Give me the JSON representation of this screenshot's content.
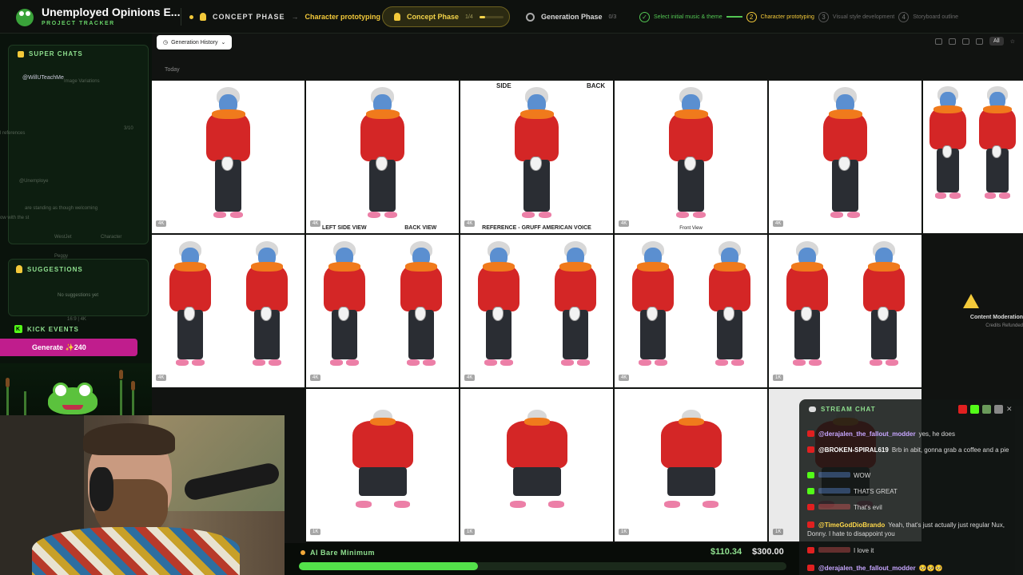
{
  "header": {
    "app_title": "Unemployed Opinions E...",
    "app_subtitle": "PROJECT TRACKER",
    "breadcrumb_phase": "CONCEPT PHASE",
    "breadcrumb_sep": "→",
    "breadcrumb_step": "Character prototyping",
    "concept_pill": {
      "label": "Concept Phase",
      "count": "1/4",
      "progress": 0.25
    },
    "generation_pill": {
      "label": "Generation Phase",
      "count": "0/3"
    },
    "steps": [
      {
        "num": "✓",
        "label": "Select initial music & theme",
        "state": "done"
      },
      {
        "num": "2",
        "label": "Character prototyping",
        "state": "current"
      },
      {
        "num": "3",
        "label": "Visual style development",
        "state": "pending"
      },
      {
        "num": "4",
        "label": "Storyboard outline",
        "state": "pending"
      }
    ]
  },
  "gallery": {
    "history_button": "Generation History",
    "history_chevron": "⌄",
    "date_group": "Today",
    "filter_all": "All",
    "tile_captions": {
      "r1c2_left": "LEFT SIDE VIEW",
      "r1c2_right": "BACK VIEW",
      "r1c3_top_left": "SIDE",
      "r1c3_top_right": "BACK",
      "r1c3_bottom": "REFERENCE - GRUFF AMERICAN VOICE",
      "r1c4_bottom": "Front View"
    },
    "badges": [
      "4K",
      "4K",
      "4K",
      "4K",
      "4K",
      "4K",
      "4K",
      "4K",
      "4K",
      "1K",
      "1K",
      "1K",
      "1K",
      "1K",
      "1K",
      "1K",
      "1K"
    ],
    "moderation": {
      "title": "Content Moderation",
      "subtitle": "Credits Refunded"
    }
  },
  "left_panel": {
    "super_chats_title": "SUPER CHATS",
    "super_chat_user": "@WillUTeachMe",
    "ghost_image_variations": "Image Variations",
    "ghost_references": "l references",
    "ghost_counter": "3/10",
    "ghost_user": "@Unemploye",
    "ghost_desc": "are standing as though welcoming",
    "ghost_desc2": "ow with the st",
    "ghost_char1": "WestJet",
    "ghost_char2": "Peggy",
    "ghost_char_type": "Character",
    "suggestions_title": "SUGGESTIONS",
    "suggestions_empty": "No suggestions yet",
    "ghost_ratio": "16:9 | 4K",
    "kick_events_title": "KICK EVENTS",
    "kick_icon": "K",
    "generate_label": "Generate ✨240"
  },
  "goal": {
    "label": "AI Bare Minimum",
    "current": "$110.34",
    "target": "$300.00",
    "progress": 0.3678
  },
  "chat": {
    "title": "STREAM CHAT",
    "close": "✕",
    "messages": [
      {
        "platform": "youtube",
        "user": "@derajalen_the_fallout_modder",
        "text": "yes, he does",
        "user_color": "#c7a6ff"
      },
      {
        "platform": "youtube",
        "user": "@BROKEN-SPIRAL619",
        "text": "Brb in abit, gonna grab a coffee and a pie",
        "user_color": "#ffffff"
      },
      {
        "platform": "kick",
        "user": "",
        "text": "WOW",
        "user_color": "#6aa0ff"
      },
      {
        "platform": "kick",
        "user": "",
        "text": "THATS GREAT",
        "user_color": "#6aa0ff"
      },
      {
        "platform": "youtube",
        "user": "",
        "text": "That's evil",
        "user_color": "#ff6060"
      },
      {
        "platform": "youtube",
        "user": "@TimeGodDioBrando",
        "text": "Yeah, that's just actually just regular Nux, Donny. I hate to disappoint you",
        "user_color": "#ffd84a"
      },
      {
        "platform": "youtube",
        "user": "",
        "text": "I love it",
        "user_color": "#ff6060"
      },
      {
        "platform": "youtube",
        "user": "@derajalen_the_fallout_modder",
        "text": "🥺🥺🥺",
        "user_color": "#c7a6ff"
      }
    ]
  },
  "colors": {
    "accent_green": "#53c653",
    "accent_yellow": "#f3c93a",
    "kick_green": "#53fc18",
    "youtube_red": "#e02020",
    "generate_magenta": "#c01d8d"
  }
}
